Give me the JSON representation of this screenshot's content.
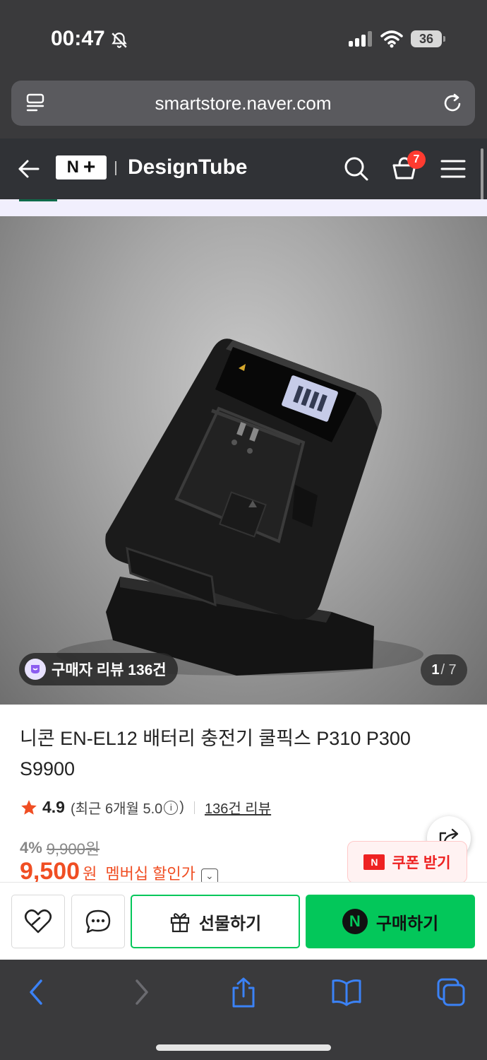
{
  "status_bar": {
    "time": "00:47",
    "battery": "36"
  },
  "browser": {
    "url": "smartstore.naver.com"
  },
  "store_header": {
    "logo_n": "N",
    "logo_plus": "+",
    "store_name": "DesignTube",
    "cart_count": "7"
  },
  "gallery": {
    "review_badge": "구매자 리뷰 136건",
    "current_page": "1",
    "total_pages": "/ 7"
  },
  "product": {
    "title": "니콘 EN-EL12 배터리 충전기 쿨픽스 P310 P300 S9900",
    "rating": "4.9",
    "recent_rating": "(최근 6개월 5.0",
    "recent_close": ")",
    "review_link": "136건 리뷰",
    "discount": "4%",
    "original_price": "9,900원",
    "price": "9,500",
    "price_unit": "원",
    "price_label": "멤버십 할인가",
    "coupon": {
      "label": "쿠폰 받기",
      "logo": "N"
    }
  },
  "actions": {
    "gift": "선물하기",
    "buy": "구매하기",
    "buy_logo": "N"
  },
  "colors": {
    "naver_green": "#03c75a",
    "price_red": "#f04e23",
    "coupon_red": "#ee2222"
  }
}
